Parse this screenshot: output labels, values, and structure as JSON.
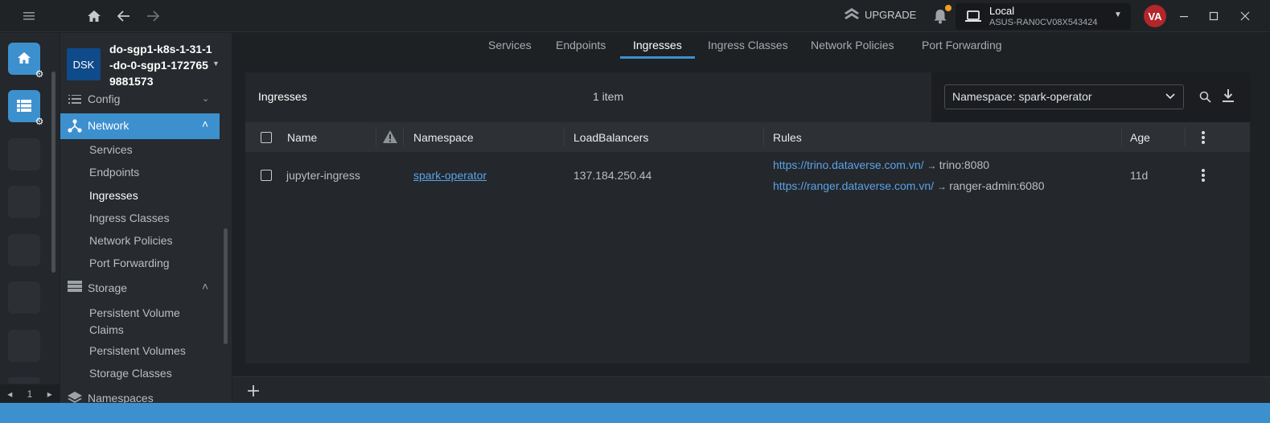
{
  "titlebar": {
    "upgrade_label": "UPGRADE",
    "cluster": {
      "title": "Local",
      "subtitle": "ASUS-RAN0CV08X543424"
    },
    "avatar_initials": "VA",
    "notification_dot_color": "#f0a020"
  },
  "hotbar": {
    "page": "1"
  },
  "sidebar": {
    "badge": "DSK",
    "cluster_name": "do-sgp1-k8s-1-31-1-do-0-sgp1-1727659881573",
    "config_label": "Config",
    "network_label": "Network",
    "network_items": [
      "Services",
      "Endpoints",
      "Ingresses",
      "Ingress Classes",
      "Network Policies",
      "Port Forwarding"
    ],
    "storage_label": "Storage",
    "storage_items": [
      "Persistent Volume Claims",
      "Persistent Volumes",
      "Storage Classes"
    ],
    "namespaces_label": "Namespaces"
  },
  "tabs": [
    "Services",
    "Endpoints",
    "Ingresses",
    "Ingress Classes",
    "Network Policies",
    "Port Forwarding"
  ],
  "panel": {
    "title": "Ingresses",
    "count": "1 item",
    "namespace_select": "Namespace: spark-operator",
    "columns": {
      "name": "Name",
      "namespace": "Namespace",
      "loadbalancers": "LoadBalancers",
      "rules": "Rules",
      "age": "Age"
    },
    "rows": [
      {
        "name": "jupyter-ingress",
        "namespace": "spark-operator",
        "loadbalancers": "137.184.250.44",
        "rules": [
          {
            "url": "https://trino.dataverse.com.vn/",
            "target": "trino:8080"
          },
          {
            "url": "https://ranger.dataverse.com.vn/",
            "target": "ranger-admin:6080"
          }
        ],
        "age": "11d"
      }
    ]
  },
  "colors": {
    "accent": "#3d90ce",
    "link": "#5aa3e8",
    "avatar": "#b3262b"
  }
}
